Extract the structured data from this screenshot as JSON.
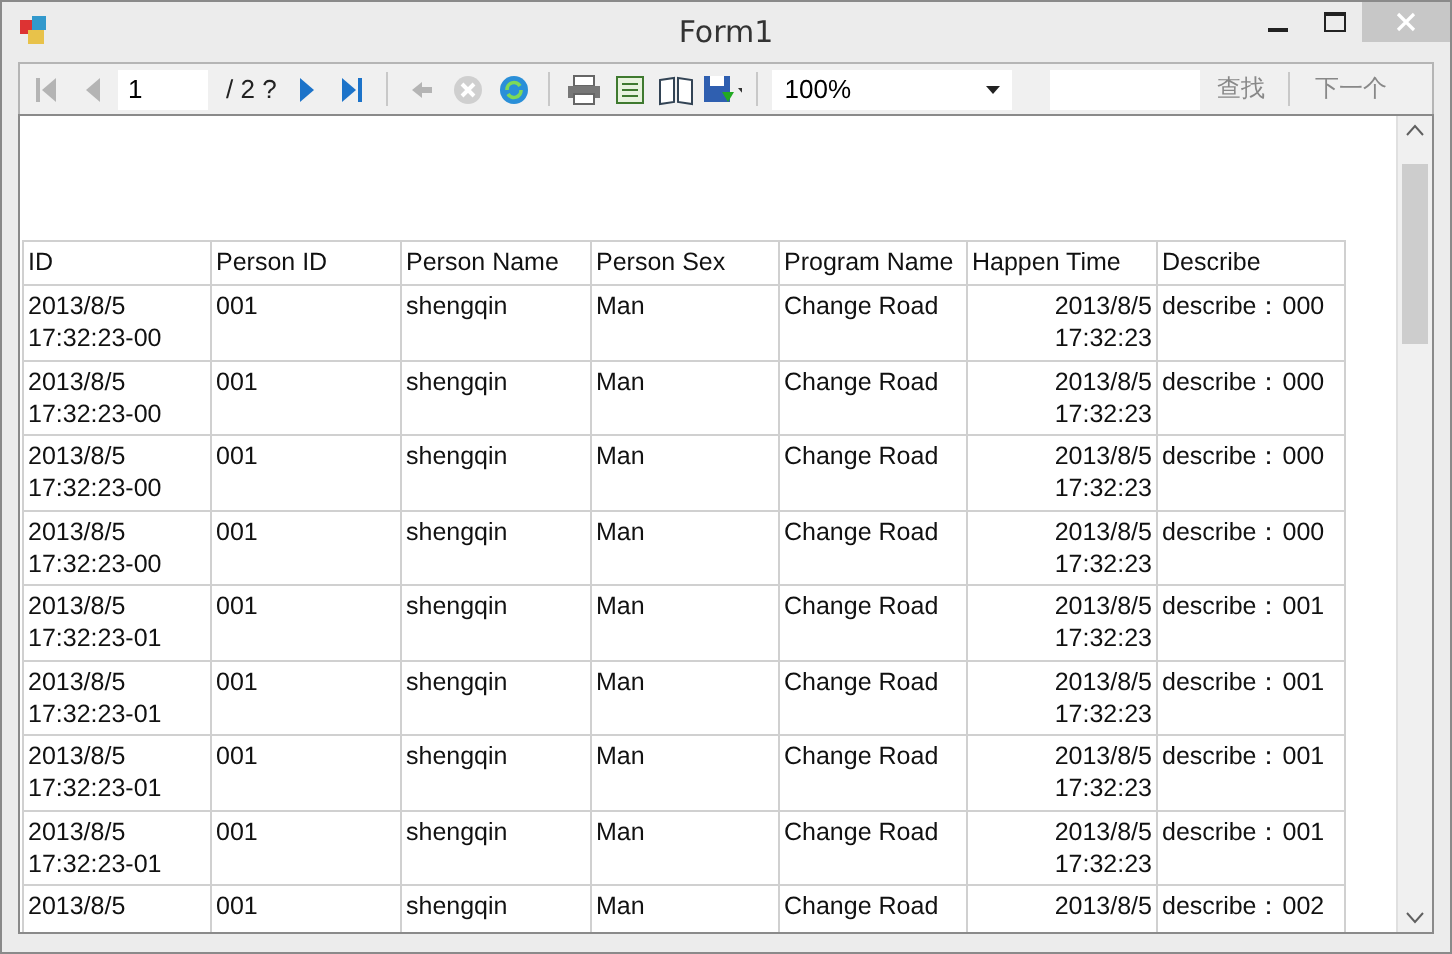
{
  "window": {
    "title": "Form1"
  },
  "toolbar": {
    "nav_start": [
      {
        "kind": "first",
        "disabled": true
      },
      {
        "kind": "previous",
        "disabled": true
      }
    ],
    "page": "1",
    "page_total": "/ 2 ?",
    "nav_end": [
      {
        "kind": "next",
        "disabled": false
      },
      {
        "kind": "last",
        "disabled": false
      }
    ],
    "actions": [
      {
        "kind": "back",
        "disabled": true
      },
      {
        "kind": "stop",
        "disabled": true
      },
      {
        "kind": "refresh",
        "disabled": false
      },
      {
        "kind": "print",
        "disabled": false
      },
      {
        "kind": "layout",
        "disabled": false
      },
      {
        "kind": "setup",
        "disabled": false
      },
      {
        "kind": "export",
        "disabled": false
      }
    ],
    "zoom": "100%",
    "find": "查找",
    "find_next": "下一个"
  },
  "table": {
    "columns": [
      "ID",
      "Person ID",
      "Person Name",
      "Person Sex",
      "Program Name",
      "Happen Time",
      "Describe"
    ],
    "rows": [
      {
        "id": [
          "2013/8/5",
          "17:32:23-00"
        ],
        "person_id": "001",
        "person_name": "shengqin",
        "person_sex": "Man",
        "program_name": "Change Road",
        "happen_time": [
          "2013/8/5",
          "17:32:23"
        ],
        "describe": "describe：000"
      },
      {
        "id": [
          "2013/8/5",
          "17:32:23-00"
        ],
        "person_id": "001",
        "person_name": "shengqin",
        "person_sex": "Man",
        "program_name": "Change Road",
        "happen_time": [
          "2013/8/5",
          "17:32:23"
        ],
        "describe": "describe：000"
      },
      {
        "id": [
          "2013/8/5",
          "17:32:23-00"
        ],
        "person_id": "001",
        "person_name": "shengqin",
        "person_sex": "Man",
        "program_name": "Change Road",
        "happen_time": [
          "2013/8/5",
          "17:32:23"
        ],
        "describe": "describe：000"
      },
      {
        "id": [
          "2013/8/5",
          "17:32:23-00"
        ],
        "person_id": "001",
        "person_name": "shengqin",
        "person_sex": "Man",
        "program_name": "Change Road",
        "happen_time": [
          "2013/8/5",
          "17:32:23"
        ],
        "describe": "describe：000"
      },
      {
        "id": [
          "2013/8/5",
          "17:32:23-01"
        ],
        "person_id": "001",
        "person_name": "shengqin",
        "person_sex": "Man",
        "program_name": "Change Road",
        "happen_time": [
          "2013/8/5",
          "17:32:23"
        ],
        "describe": "describe：001"
      },
      {
        "id": [
          "2013/8/5",
          "17:32:23-01"
        ],
        "person_id": "001",
        "person_name": "shengqin",
        "person_sex": "Man",
        "program_name": "Change Road",
        "happen_time": [
          "2013/8/5",
          "17:32:23"
        ],
        "describe": "describe：001"
      },
      {
        "id": [
          "2013/8/5",
          "17:32:23-01"
        ],
        "person_id": "001",
        "person_name": "shengqin",
        "person_sex": "Man",
        "program_name": "Change Road",
        "happen_time": [
          "2013/8/5",
          "17:32:23"
        ],
        "describe": "describe：001"
      },
      {
        "id": [
          "2013/8/5",
          "17:32:23-01"
        ],
        "person_id": "001",
        "person_name": "shengqin",
        "person_sex": "Man",
        "program_name": "Change Road",
        "happen_time": [
          "2013/8/5",
          "17:32:23"
        ],
        "describe": "describe：001"
      },
      {
        "id": [
          "2013/8/5"
        ],
        "person_id": "001",
        "person_name": "shengqin",
        "person_sex": "Man",
        "program_name": "Change Road",
        "happen_time": [
          "2013/8/5"
        ],
        "describe": "describe：002"
      }
    ]
  }
}
